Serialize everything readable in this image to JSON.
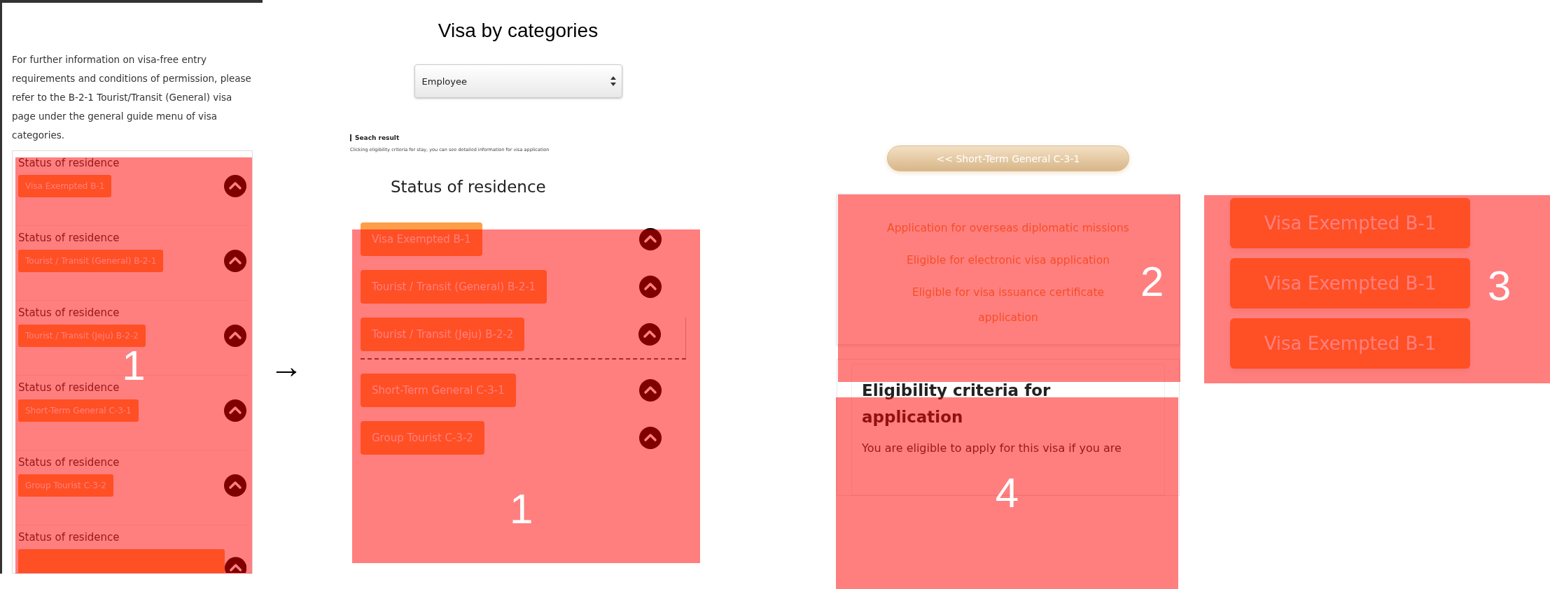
{
  "left_panel": {
    "intro": "For further information on visa-free entry requirements and conditions of permission, please refer to the B-2-1 Tourist/Transit (General) visa page under the general guide menu of visa categories.",
    "items": [
      {
        "label": "Status of residence",
        "chip": "Visa Exempted B-1"
      },
      {
        "label": "Status of residence",
        "chip": "Tourist / Transit (General) B-2-1"
      },
      {
        "label": "Status of residence",
        "chip": "Tourist / Transit (Jeju) B-2-2"
      },
      {
        "label": "Status of residence",
        "chip": "Short-Term General C-3-1"
      },
      {
        "label": "Status of residence",
        "chip": "Group Tourist C-3-2"
      },
      {
        "label": "Status of residence"
      }
    ],
    "callout": "1"
  },
  "arrow": "→",
  "middle_panel": {
    "title": "Visa by categories",
    "select": {
      "value": "Employee"
    },
    "result_heading": "Seach result",
    "result_note": "Clicking eligibility criteria for stay, you can see detailed information for visa application",
    "section_title": "Status of residence",
    "chips": [
      {
        "label": "Visa Exempted B-1",
        "focused": false
      },
      {
        "label": "Tourist / Transit (General) B-2-1",
        "focused": false
      },
      {
        "label": "Tourist / Transit (Jeju) B-2-2",
        "focused": true
      },
      {
        "label": "Short-Term General C-3-1",
        "focused": false
      },
      {
        "label": "Group Tourist C-3-2",
        "focused": false
      }
    ],
    "callout": "1"
  },
  "right_panel": {
    "back_button": "<< Short-Term General C-3-1",
    "options": [
      "Application for overseas diplomatic missions",
      "Eligible for electronic visa application",
      "Eligible for visa issuance certificate application"
    ],
    "options_callout": "2",
    "criteria_title": "Eligibility criteria for application",
    "criteria_text": "You are eligible to apply for this visa if you are",
    "criteria_callout": "4"
  },
  "far_right_panel": {
    "chips": [
      "Visa Exempted B-1",
      "Visa Exempted B-1",
      "Visa Exempted B-1"
    ],
    "callout": "3"
  }
}
